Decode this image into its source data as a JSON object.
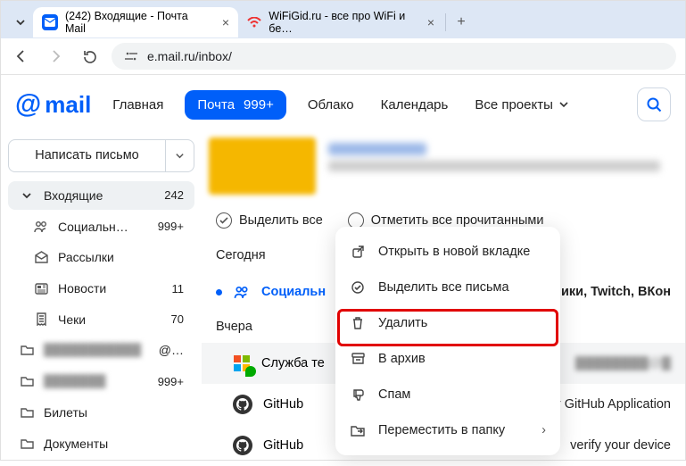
{
  "browser": {
    "tabs": [
      {
        "title": "(242) Входящие - Почта Mail",
        "favicon": "mail-envelope-icon",
        "active": true
      },
      {
        "title": "WiFiGid.ru - все про WiFi и бе…",
        "favicon": "wifi-icon",
        "active": false
      }
    ],
    "url": "e.mail.ru/inbox/"
  },
  "header": {
    "logo": "mail",
    "nav": {
      "home": "Главная",
      "mail": "Почта",
      "mail_count": "999+",
      "cloud": "Облако",
      "calendar": "Календарь",
      "projects": "Все проекты"
    }
  },
  "sidebar": {
    "compose": "Написать письмо",
    "items": [
      {
        "icon": "chevron-down-icon",
        "label": "Входящие",
        "count": "242",
        "active": true
      },
      {
        "icon": "people-icon",
        "label": "Социальн…",
        "count": "999+",
        "sub": true
      },
      {
        "icon": "envelope-open-icon",
        "label": "Рассылки",
        "count": "",
        "sub": true
      },
      {
        "icon": "newspaper-icon",
        "label": "Новости",
        "count": "11",
        "sub": true
      },
      {
        "icon": "receipt-icon",
        "label": "Чеки",
        "count": "70",
        "sub": true
      },
      {
        "icon": "folder-icon",
        "label": "blurred-folder-1",
        "count": "",
        "blur": true,
        "suffix": "@…"
      },
      {
        "icon": "folder-icon",
        "label": "blurred-folder-2",
        "count": "999+",
        "blur": true
      },
      {
        "icon": "folder-icon",
        "label": "Билеты",
        "count": ""
      },
      {
        "icon": "folder-icon",
        "label": "Документы",
        "count": ""
      }
    ]
  },
  "toolbar": {
    "select_all": "Выделить все",
    "mark_read": "Отметить все прочитанными"
  },
  "messages": {
    "today_header": "Сегодня",
    "yesterday_header": "Вчера",
    "rows": [
      {
        "icon": "people-icon",
        "from": "Социальн",
        "social": true,
        "subject": "ики, Twitch, ВКон"
      },
      {
        "icon": "microsoft-icon",
        "from": "Служба те",
        "subject": ""
      },
      {
        "icon": "github-icon",
        "from": "GitHub",
        "subject": "y GitHub Application"
      },
      {
        "icon": "github-icon",
        "from": "GitHub",
        "subject": "verify your device"
      }
    ]
  },
  "context_menu": {
    "items": [
      {
        "icon": "external-icon",
        "label": "Открыть в новой вкладке"
      },
      {
        "icon": "select-all-icon",
        "label": "Выделить все письма"
      },
      {
        "icon": "trash-icon",
        "label": "Удалить",
        "hl": true
      },
      {
        "icon": "archive-icon",
        "label": "В архив"
      },
      {
        "icon": "thumbs-down-icon",
        "label": "Спам"
      },
      {
        "icon": "folder-move-icon",
        "label": "Переместить в папку",
        "submenu": true
      }
    ]
  }
}
